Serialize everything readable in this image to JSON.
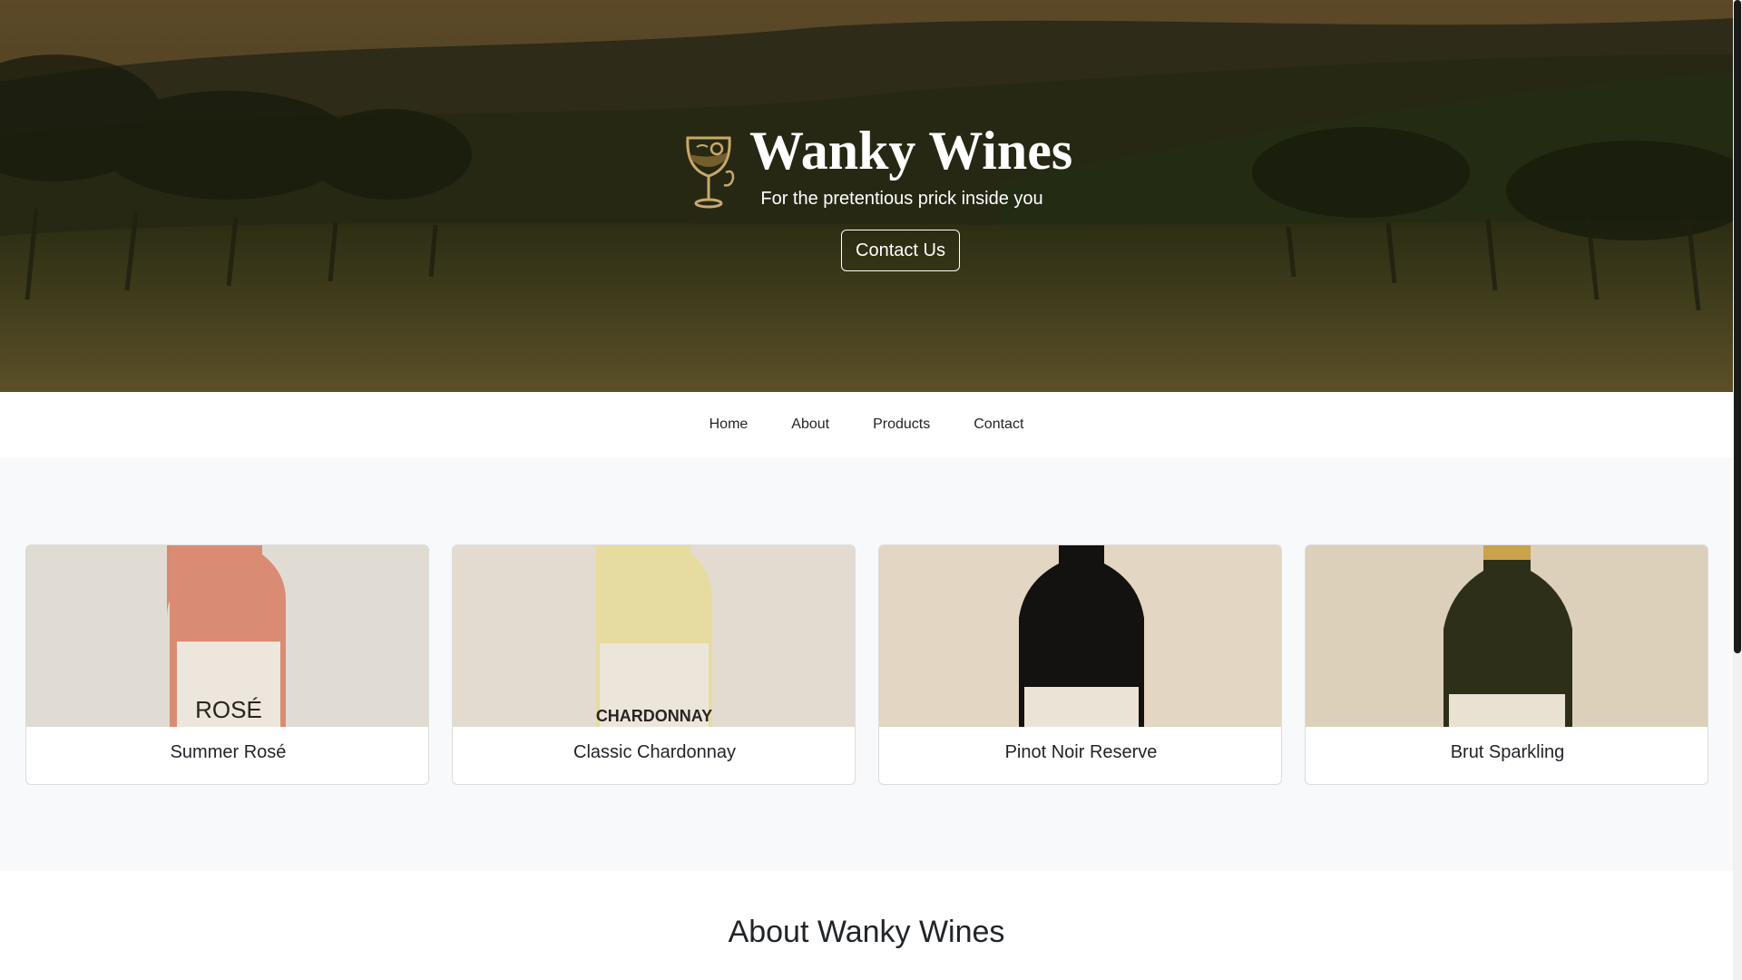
{
  "hero": {
    "site_title": "Wanky Wines",
    "tagline": "For the pretentious prick inside you",
    "cta_label": "Contact Us",
    "logo_icon": "wine-glass-monocle-icon"
  },
  "nav": {
    "items": [
      {
        "label": "Home"
      },
      {
        "label": "About"
      },
      {
        "label": "Products"
      },
      {
        "label": "Contact"
      }
    ]
  },
  "products": {
    "cards": [
      {
        "title": "Summer Rosé",
        "bottle_label": "ROSÉ",
        "wine_color": "#d78a72",
        "bg": "#e0dbd3"
      },
      {
        "title": "Classic Chardonnay",
        "bottle_label": "CHARDONNAY",
        "wine_color": "#e6dca0",
        "bg": "#e3dbd0"
      },
      {
        "title": "Pinot Noir Reserve",
        "bottle_label": "",
        "wine_color": "#141210",
        "bg": "#e3d6c2"
      },
      {
        "title": "Brut Sparkling",
        "bottle_label": "",
        "wine_color": "#2e2f18",
        "bg": "#ddd0bb"
      }
    ]
  },
  "about": {
    "heading": "About Wanky Wines"
  }
}
